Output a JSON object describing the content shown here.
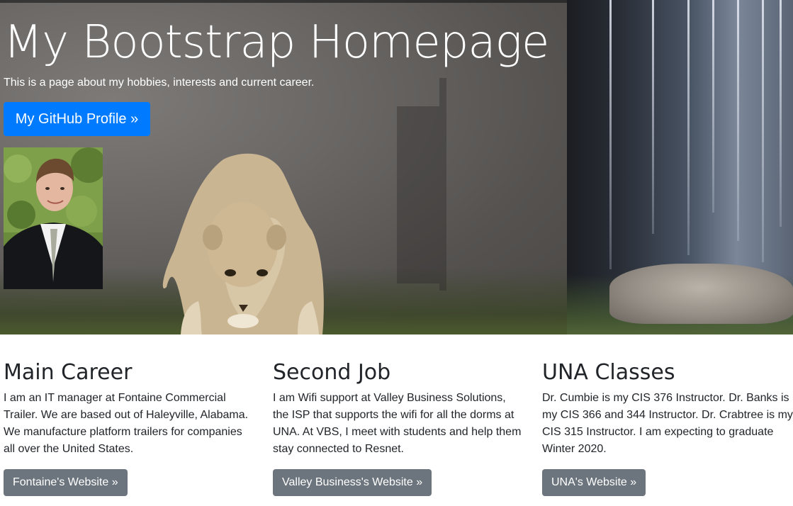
{
  "hero": {
    "title": "My Bootstrap Homepage",
    "lead": "This is a page about my hobbies, interests and current career.",
    "github_button": "My GitHub Profile »"
  },
  "columns": [
    {
      "heading": "Main Career",
      "text": "I am an IT manager at Fontaine Commercial Trailer. We are based out of Haleyville, Alabama. We manufacture platform trailers for companies all over the United States.",
      "button": "Fontaine's Website »"
    },
    {
      "heading": "Second Job",
      "text": "I am Wifi support at Valley Business Solutions, the ISP that supports the wifi for all the dorms at UNA. At VBS, I meet with students and help them stay connected to Resnet.",
      "button": "Valley Business's Website »"
    },
    {
      "heading": "UNA Classes",
      "text": "Dr. Cumbie is my CIS 376 Instructor. Dr. Banks is my CIS 366 and 344 Instructor. Dr. Crabtree is my CIS 315 Instructor. I am expecting to graduate Winter 2020.",
      "button": "UNA's Website »"
    }
  ],
  "colors": {
    "primary": "#007bff",
    "secondary": "#6c757d",
    "text": "#212529"
  }
}
